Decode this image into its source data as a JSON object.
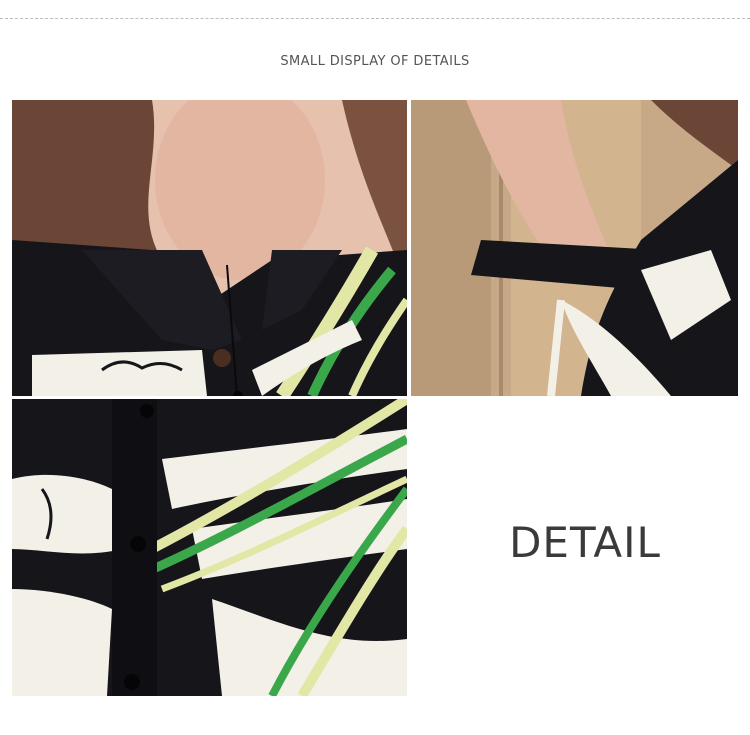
{
  "header": {
    "title": "SMALL DISPLAY OF DETAILS"
  },
  "detail_label": "DETAIL",
  "colors": {
    "shirt_black": "#15151a",
    "print_white": "#f3f0e8",
    "print_green": "#3aa84a",
    "print_yellow": "#e2e7a6",
    "skin": "#e3b6a2",
    "hair": "#6b4636",
    "cabinet_wood": "#c7a987"
  }
}
